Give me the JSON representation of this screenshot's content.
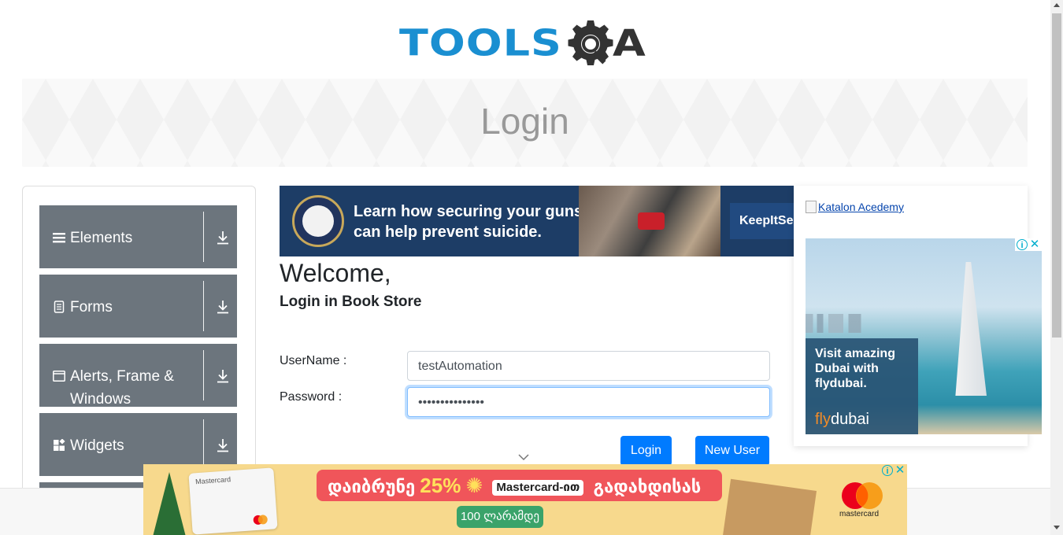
{
  "header": {
    "logo_text_left": "TOOLS",
    "logo_text_right": "A",
    "logo_icon": "gear-magnifier-icon"
  },
  "banner": {
    "title": "Login"
  },
  "sidebar": {
    "groups": [
      {
        "label": "Elements",
        "icon": "hamburger-icon"
      },
      {
        "label": "Forms",
        "icon": "document-icon"
      },
      {
        "label": "Alerts, Frame & Windows",
        "icon": "window-icon"
      },
      {
        "label": "Widgets",
        "icon": "widgets-icon"
      }
    ]
  },
  "top_ad": {
    "headline_line1": "Learn how securing your guns",
    "headline_line2": "can help prevent suicide.",
    "cta": "KeepItSec"
  },
  "main": {
    "heading": "Welcome,",
    "subheading": "Login in Book Store",
    "username_label": "UserName :",
    "username_value": "testAutomation",
    "password_label": "Password :",
    "password_value": "•••••••••••••••",
    "login_button": "Login",
    "new_user_button": "New User"
  },
  "right_ad": {
    "broken_image_alt": "Katalon Acedemy",
    "dubai_text": "Visit amazing Dubai with flydubai.",
    "brand_fly": "fly",
    "brand_dubai": "dubai",
    "ad_info": "i",
    "ad_close": "✕"
  },
  "bottom_ad": {
    "card_brand": "Mastercard",
    "promo_prefix": "დაიბრუნე",
    "promo_percent": "25%",
    "promo_tag": "Mastercard-ით",
    "promo_suffix": "გადახდისას",
    "pill": "100 ლარამდე",
    "logo_name": "mastercard",
    "ad_info": "i",
    "ad_close": "✕"
  },
  "colors": {
    "primary_button": "#007bff",
    "sidebar_group": "#6c757d",
    "logo_blue": "#1a8fd1",
    "logo_dark": "#333333"
  }
}
